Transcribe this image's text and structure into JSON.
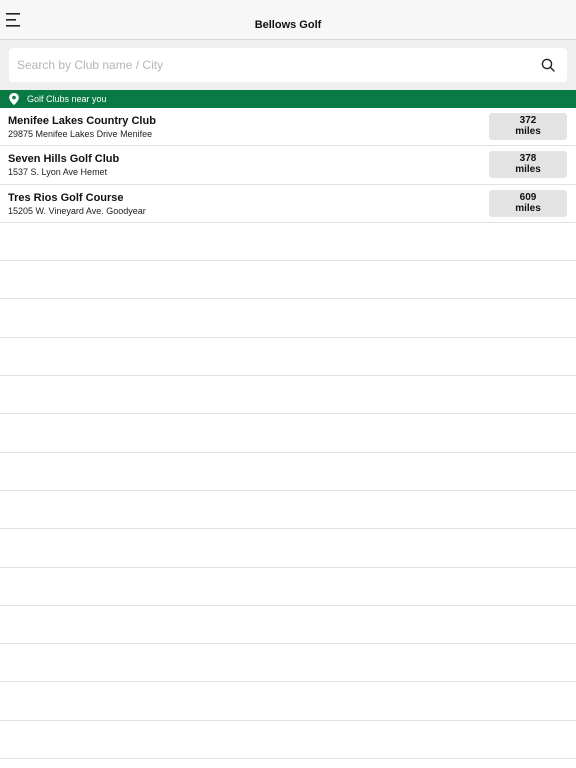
{
  "header": {
    "title": "Bellows Golf",
    "menu_icon": "hamburger-menu-icon"
  },
  "search": {
    "placeholder": "Search by Club name / City",
    "value": "",
    "icon": "search-icon"
  },
  "section": {
    "label": "Golf Clubs near you",
    "icon": "location-pin-icon",
    "color": "#0a7a45"
  },
  "clubs": [
    {
      "name": "Menifee Lakes Country Club",
      "address": "29875 Menifee Lakes Drive Menifee",
      "distance": "372",
      "unit": "miles"
    },
    {
      "name": "Seven Hills Golf Club",
      "address": "1537 S. Lyon Ave Hemet",
      "distance": "378",
      "unit": "miles"
    },
    {
      "name": "Tres Rios Golf Course",
      "address": "15205 W. Vineyard Ave. Goodyear",
      "distance": "609",
      "unit": "miles"
    }
  ]
}
